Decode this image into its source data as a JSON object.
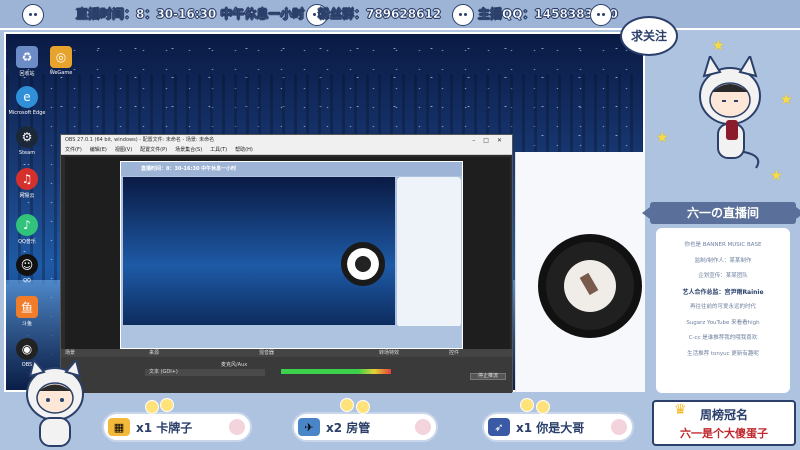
{
  "header": {
    "schedule": "直播时间：8：30-16:30 中午休息一小时",
    "fan_group": "粉丝群：789628612",
    "host_qq": "主播QQ：1458383830"
  },
  "desktop_icons": [
    {
      "label": "回收站",
      "icon": "recycle-bin-icon",
      "color": "#6b8cc7"
    },
    {
      "label": "WeGame",
      "icon": "wegame-icon",
      "color": "#e7a32b"
    },
    {
      "label": "Microsoft Edge",
      "icon": "edge-icon",
      "color": "#2f8fd8"
    },
    {
      "label": "Steam",
      "icon": "steam-icon",
      "color": "#1b2838"
    },
    {
      "label": "网易云",
      "icon": "netease-music-icon",
      "color": "#d4312d"
    },
    {
      "label": "QQ音乐",
      "icon": "qq-music-icon",
      "color": "#31c27c"
    },
    {
      "label": "QQ",
      "icon": "qq-icon",
      "color": "#111111"
    },
    {
      "label": "斗鱼",
      "icon": "douyu-icon",
      "color": "#f17d2b"
    },
    {
      "label": "OBS",
      "icon": "obs-icon",
      "color": "#222222"
    }
  ],
  "obs": {
    "title": "OBS 27.0.1 (64 bit, windows) - 配置文件: 未命名 - 场景: 未命名",
    "menu": [
      "文件(F)",
      "编辑(E)",
      "视图(V)",
      "配置文件(P)",
      "场景集合(S)",
      "工具(T)",
      "帮助(H)"
    ],
    "docks": [
      "场景",
      "来源",
      "混音器",
      "转场特效",
      "控件"
    ],
    "source_name": "文本 (GDI+)",
    "audio_source": "麦克风/Aux",
    "button": "停止推流"
  },
  "sidebar": {
    "speech": "求关注",
    "ribbon": "六一の直播间",
    "credits": [
      {
        "text": "你也是 BANNER MUSIC BASE",
        "bold": false
      },
      {
        "text": "监制/制作人：某某制作",
        "bold": false
      },
      {
        "text": "企划宣传：某某团队",
        "bold": false
      },
      {
        "text": "艺人合作总监：宫尹雨Rainie",
        "bold": true
      },
      {
        "text": "再往往前的可爱永远的时代",
        "bold": false
      },
      {
        "text": "Sugarz YouTube 来看看high",
        "bold": false
      },
      {
        "text": "C-cc 是谁推荐我的哦我喜欢",
        "bold": false
      },
      {
        "text": "生活推荐 tonyuc 更新有趣呢",
        "bold": false
      }
    ]
  },
  "gifts": [
    {
      "text": "x1 卡牌子",
      "icon": "card-gift-icon",
      "color": "#f2b93b"
    },
    {
      "text": "x2 房管",
      "icon": "admin-gift-icon",
      "color": "#4a86c7"
    },
    {
      "text": "x1 你是大哥",
      "icon": "rocket-gift-icon",
      "color": "#3a5aa6"
    }
  ],
  "weekly": {
    "title": "周榜冠名",
    "name": "六一是个大傻蛋子"
  },
  "colors": {
    "frame": "#aec3e0",
    "navy": "#2a3f6a",
    "accent_red": "#c0282e"
  }
}
